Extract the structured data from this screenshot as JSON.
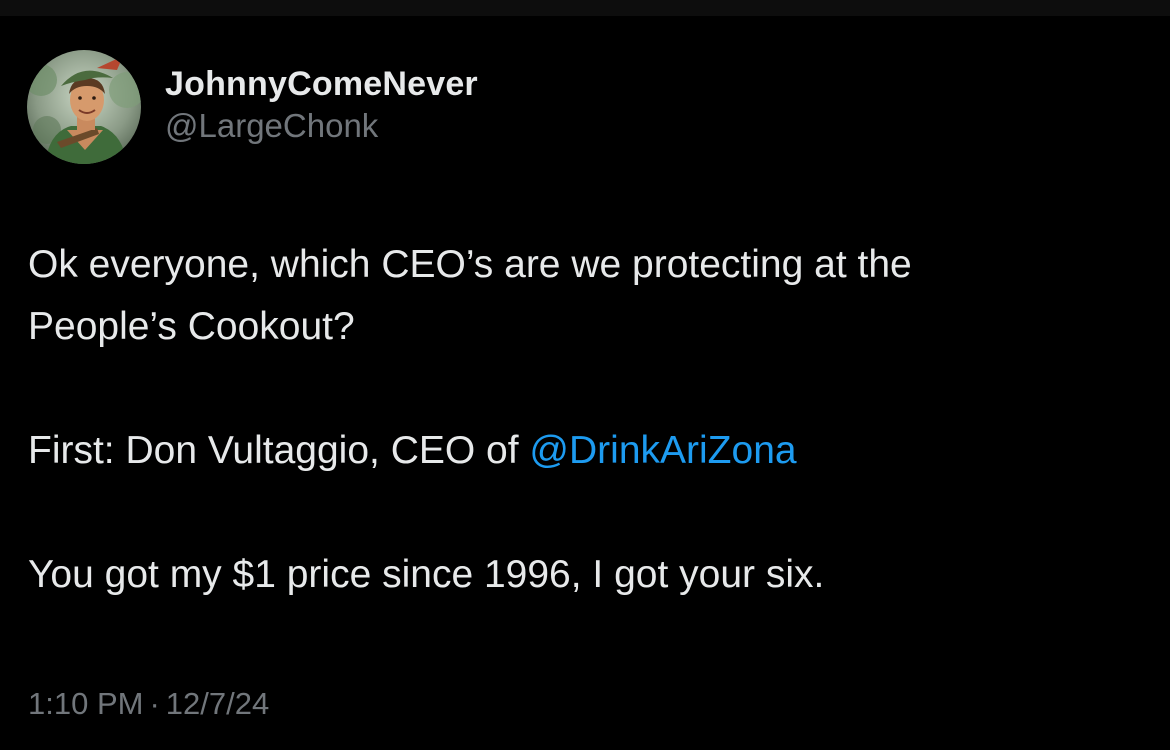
{
  "author": {
    "display_name": "JohnnyComeNever",
    "handle": "@LargeChonk"
  },
  "tweet": {
    "line1": "Ok everyone, which CEO’s are we protecting at the",
    "line2": "People’s Cookout?",
    "line3_prefix": "First: Don Vultaggio,  CEO of ",
    "line3_mention": "@DrinkAriZona",
    "line4": "You got my $1 price since 1996, I got your six."
  },
  "meta": {
    "time": "1:10 PM",
    "separator": "·",
    "date": "12/7/24"
  },
  "colors": {
    "background": "#000000",
    "text": "#e7e9ea",
    "secondary": "#71767b",
    "mention": "#1d9bf0"
  },
  "icons": {
    "avatar": "profile-photo"
  }
}
